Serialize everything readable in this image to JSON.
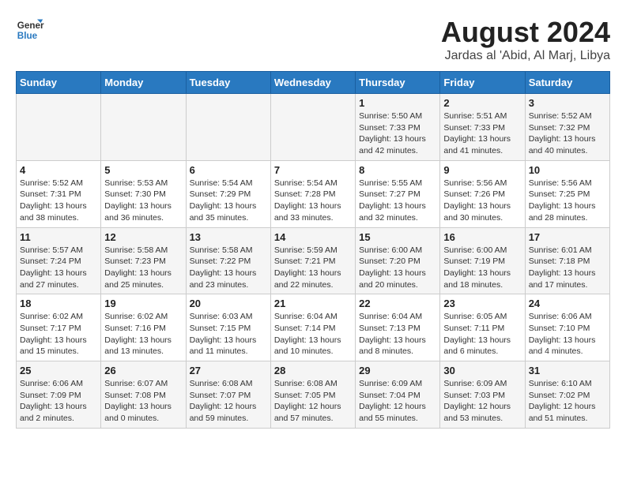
{
  "header": {
    "logo_line1": "General",
    "logo_line2": "Blue",
    "title": "August 2024",
    "subtitle": "Jardas al 'Abid, Al Marj, Libya"
  },
  "weekdays": [
    "Sunday",
    "Monday",
    "Tuesday",
    "Wednesday",
    "Thursday",
    "Friday",
    "Saturday"
  ],
  "weeks": [
    [
      {
        "day": "",
        "info": ""
      },
      {
        "day": "",
        "info": ""
      },
      {
        "day": "",
        "info": ""
      },
      {
        "day": "",
        "info": ""
      },
      {
        "day": "1",
        "info": "Sunrise: 5:50 AM\nSunset: 7:33 PM\nDaylight: 13 hours and 42 minutes."
      },
      {
        "day": "2",
        "info": "Sunrise: 5:51 AM\nSunset: 7:33 PM\nDaylight: 13 hours and 41 minutes."
      },
      {
        "day": "3",
        "info": "Sunrise: 5:52 AM\nSunset: 7:32 PM\nDaylight: 13 hours and 40 minutes."
      }
    ],
    [
      {
        "day": "4",
        "info": "Sunrise: 5:52 AM\nSunset: 7:31 PM\nDaylight: 13 hours and 38 minutes."
      },
      {
        "day": "5",
        "info": "Sunrise: 5:53 AM\nSunset: 7:30 PM\nDaylight: 13 hours and 36 minutes."
      },
      {
        "day": "6",
        "info": "Sunrise: 5:54 AM\nSunset: 7:29 PM\nDaylight: 13 hours and 35 minutes."
      },
      {
        "day": "7",
        "info": "Sunrise: 5:54 AM\nSunset: 7:28 PM\nDaylight: 13 hours and 33 minutes."
      },
      {
        "day": "8",
        "info": "Sunrise: 5:55 AM\nSunset: 7:27 PM\nDaylight: 13 hours and 32 minutes."
      },
      {
        "day": "9",
        "info": "Sunrise: 5:56 AM\nSunset: 7:26 PM\nDaylight: 13 hours and 30 minutes."
      },
      {
        "day": "10",
        "info": "Sunrise: 5:56 AM\nSunset: 7:25 PM\nDaylight: 13 hours and 28 minutes."
      }
    ],
    [
      {
        "day": "11",
        "info": "Sunrise: 5:57 AM\nSunset: 7:24 PM\nDaylight: 13 hours and 27 minutes."
      },
      {
        "day": "12",
        "info": "Sunrise: 5:58 AM\nSunset: 7:23 PM\nDaylight: 13 hours and 25 minutes."
      },
      {
        "day": "13",
        "info": "Sunrise: 5:58 AM\nSunset: 7:22 PM\nDaylight: 13 hours and 23 minutes."
      },
      {
        "day": "14",
        "info": "Sunrise: 5:59 AM\nSunset: 7:21 PM\nDaylight: 13 hours and 22 minutes."
      },
      {
        "day": "15",
        "info": "Sunrise: 6:00 AM\nSunset: 7:20 PM\nDaylight: 13 hours and 20 minutes."
      },
      {
        "day": "16",
        "info": "Sunrise: 6:00 AM\nSunset: 7:19 PM\nDaylight: 13 hours and 18 minutes."
      },
      {
        "day": "17",
        "info": "Sunrise: 6:01 AM\nSunset: 7:18 PM\nDaylight: 13 hours and 17 minutes."
      }
    ],
    [
      {
        "day": "18",
        "info": "Sunrise: 6:02 AM\nSunset: 7:17 PM\nDaylight: 13 hours and 15 minutes."
      },
      {
        "day": "19",
        "info": "Sunrise: 6:02 AM\nSunset: 7:16 PM\nDaylight: 13 hours and 13 minutes."
      },
      {
        "day": "20",
        "info": "Sunrise: 6:03 AM\nSunset: 7:15 PM\nDaylight: 13 hours and 11 minutes."
      },
      {
        "day": "21",
        "info": "Sunrise: 6:04 AM\nSunset: 7:14 PM\nDaylight: 13 hours and 10 minutes."
      },
      {
        "day": "22",
        "info": "Sunrise: 6:04 AM\nSunset: 7:13 PM\nDaylight: 13 hours and 8 minutes."
      },
      {
        "day": "23",
        "info": "Sunrise: 6:05 AM\nSunset: 7:11 PM\nDaylight: 13 hours and 6 minutes."
      },
      {
        "day": "24",
        "info": "Sunrise: 6:06 AM\nSunset: 7:10 PM\nDaylight: 13 hours and 4 minutes."
      }
    ],
    [
      {
        "day": "25",
        "info": "Sunrise: 6:06 AM\nSunset: 7:09 PM\nDaylight: 13 hours and 2 minutes."
      },
      {
        "day": "26",
        "info": "Sunrise: 6:07 AM\nSunset: 7:08 PM\nDaylight: 13 hours and 0 minutes."
      },
      {
        "day": "27",
        "info": "Sunrise: 6:08 AM\nSunset: 7:07 PM\nDaylight: 12 hours and 59 minutes."
      },
      {
        "day": "28",
        "info": "Sunrise: 6:08 AM\nSunset: 7:05 PM\nDaylight: 12 hours and 57 minutes."
      },
      {
        "day": "29",
        "info": "Sunrise: 6:09 AM\nSunset: 7:04 PM\nDaylight: 12 hours and 55 minutes."
      },
      {
        "day": "30",
        "info": "Sunrise: 6:09 AM\nSunset: 7:03 PM\nDaylight: 12 hours and 53 minutes."
      },
      {
        "day": "31",
        "info": "Sunrise: 6:10 AM\nSunset: 7:02 PM\nDaylight: 12 hours and 51 minutes."
      }
    ]
  ]
}
